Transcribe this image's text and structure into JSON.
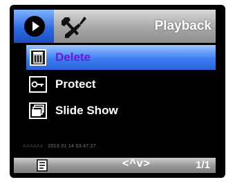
{
  "header": {
    "title": "Playback",
    "tabs": [
      {
        "icon": "play-icon",
        "active": true
      },
      {
        "icon": "setup-tools-icon",
        "active": false
      }
    ]
  },
  "menu": {
    "items": [
      {
        "label": "Delete",
        "icon": "trash-icon",
        "selected": true
      },
      {
        "label": "Protect",
        "icon": "key-icon",
        "selected": false
      },
      {
        "label": "Slide Show",
        "icon": "slideshow-icon",
        "selected": false
      }
    ]
  },
  "file": {
    "name": "AAAAAA",
    "timestamp": "2013 01 14 03:47:27"
  },
  "footer": {
    "nav": "<^v>",
    "page": "1/1",
    "icon": "document-icon"
  },
  "colors": {
    "accent": "#3d7ef2",
    "selected_text": "#6e18d6",
    "bar_gray": "#a6a6a6"
  }
}
